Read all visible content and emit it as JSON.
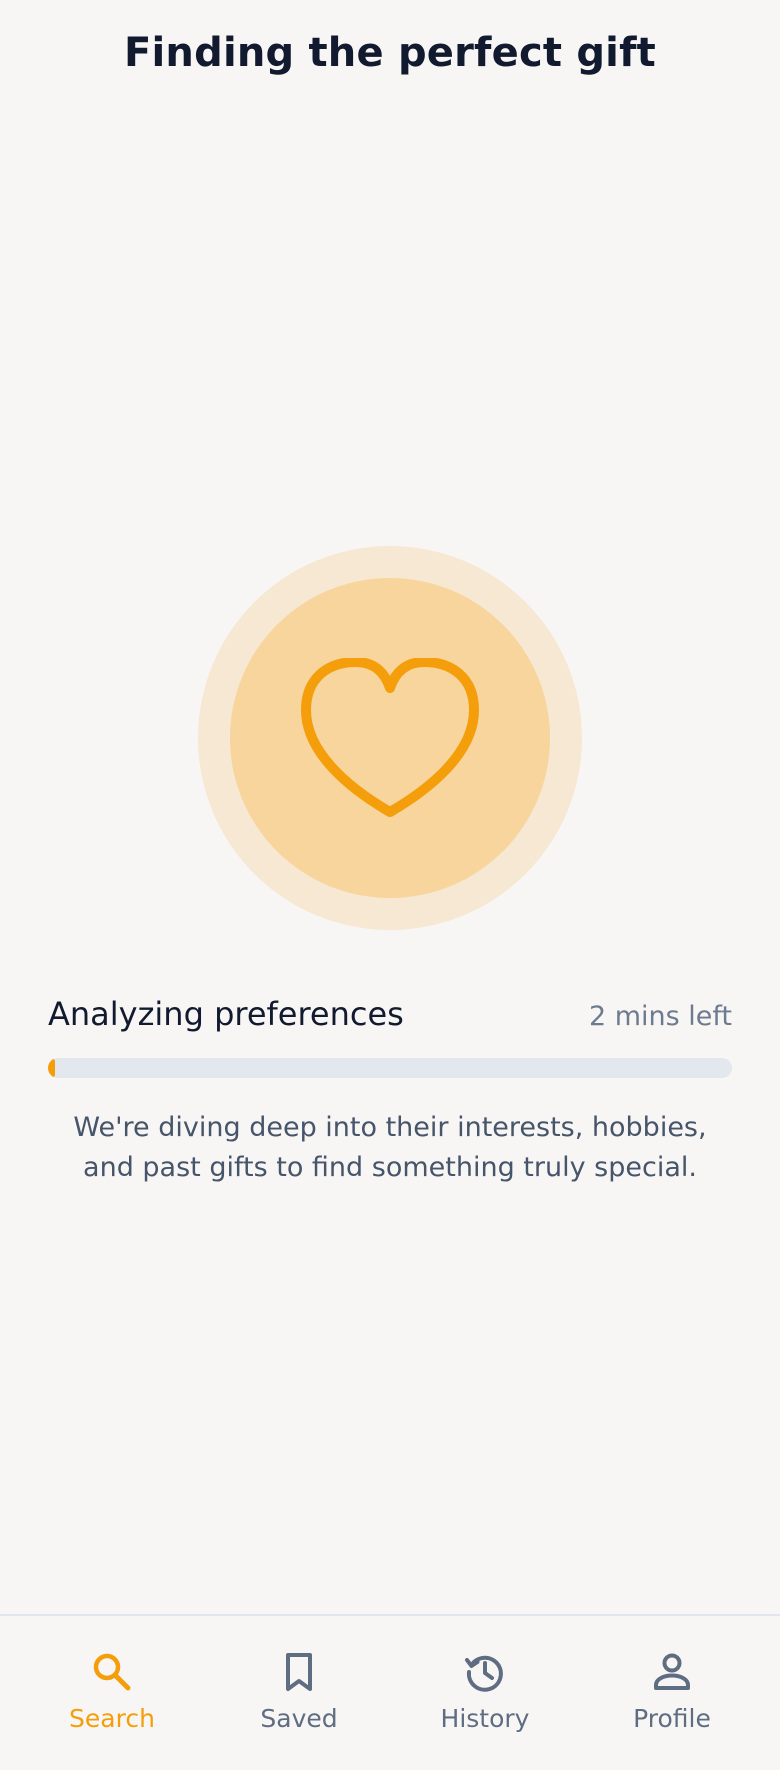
{
  "header": {
    "title": "Finding the perfect gift"
  },
  "hero": {
    "icon": "heart-icon",
    "colors": {
      "outer_ring": "#f6e8d2",
      "inner_circle": "#f7d59c",
      "icon_stroke": "#f59e0b"
    }
  },
  "status": {
    "label": "Analyzing preferences",
    "time_left": "2 mins left",
    "progress_percent": 1
  },
  "description": "We're diving deep into their interests, hobbies, and past gifts to find something truly special.",
  "bottom_nav": {
    "items": [
      {
        "label": "Search",
        "icon": "search-icon",
        "active": true
      },
      {
        "label": "Saved",
        "icon": "bookmark-icon",
        "active": false
      },
      {
        "label": "History",
        "icon": "history-icon",
        "active": false
      },
      {
        "label": "Profile",
        "icon": "profile-icon",
        "active": false
      }
    ]
  },
  "colors": {
    "accent": "#f59e0b",
    "background": "#f8f6f5",
    "title_text": "#111a2e",
    "muted_text": "#6d7b8f",
    "track": "#e3e7ee"
  }
}
